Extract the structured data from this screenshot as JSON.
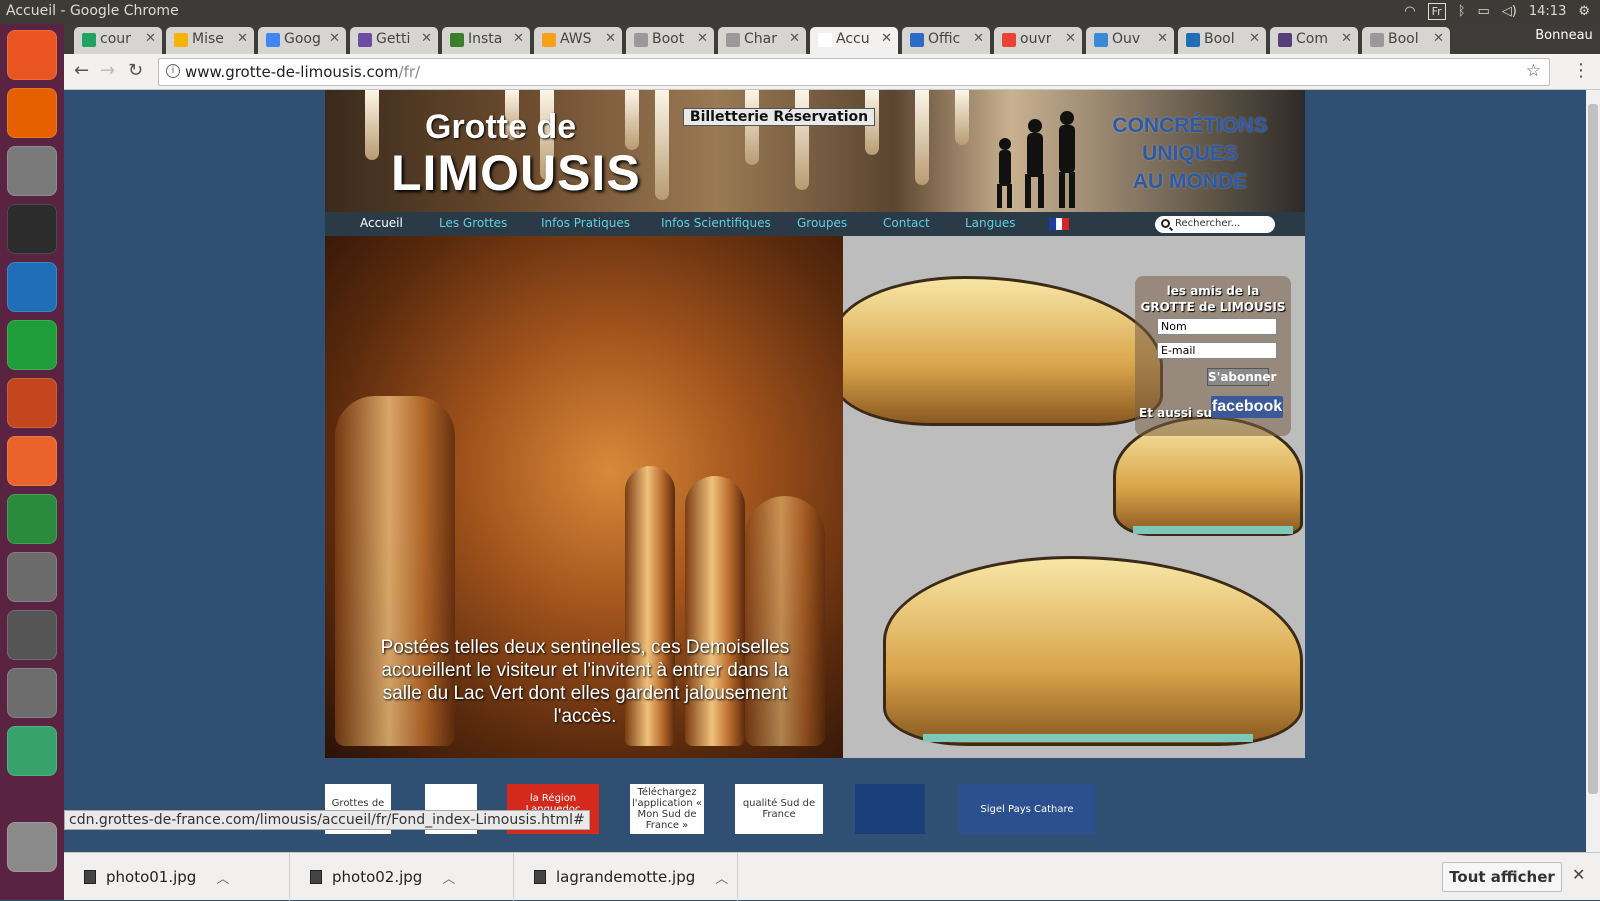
{
  "os": {
    "window_title": "Accueil - Google Chrome",
    "keyboard_layout": "Fr",
    "clock": "14:13",
    "launcher": [
      {
        "name": "ubuntu-icon",
        "color": "#e95420"
      },
      {
        "name": "firefox-icon",
        "color": "#e66000"
      },
      {
        "name": "files-icon",
        "color": "#7a7a7a"
      },
      {
        "name": "terminal-icon",
        "color": "#2c2c2c"
      },
      {
        "name": "writer-icon",
        "color": "#1e6fb8"
      },
      {
        "name": "calc-icon",
        "color": "#1f9d3a"
      },
      {
        "name": "impress-icon",
        "color": "#c3461e"
      },
      {
        "name": "software-center-icon",
        "color": "#e9632a"
      },
      {
        "name": "chrome-icon",
        "color": "#2a8b3e"
      },
      {
        "name": "settings-icon",
        "color": "#6b6b6b"
      },
      {
        "name": "sublime-text-icon",
        "color": "#555555"
      },
      {
        "name": "gimp-icon",
        "color": "#6d6d6d"
      },
      {
        "name": "atom-icon",
        "color": "#37a26b"
      },
      {
        "name": "trash-icon",
        "color": "#8a8a8a"
      }
    ]
  },
  "browser": {
    "profile": "Bonneau",
    "tabs": [
      {
        "label": "cour",
        "color": "#1fa463"
      },
      {
        "label": "Mise",
        "color": "#f4b400"
      },
      {
        "label": "Goog",
        "color": "#4285f4"
      },
      {
        "label": "Getti",
        "color": "#6c4ea3"
      },
      {
        "label": "Insta",
        "color": "#3a7d2c"
      },
      {
        "label": "AWS",
        "color": "#f7a11a"
      },
      {
        "label": "Boot",
        "color": "#999999"
      },
      {
        "label": "Char",
        "color": "#999999"
      },
      {
        "label": "Accu",
        "color": "#ffffff"
      },
      {
        "label": "Offic",
        "color": "#2a6cc7"
      },
      {
        "label": "ouvr",
        "color": "#ea4335"
      },
      {
        "label": "Ouv",
        "color": "#3a8ad6"
      },
      {
        "label": "Bool",
        "color": "#1f6fb5"
      },
      {
        "label": "Com",
        "color": "#563d7c"
      },
      {
        "label": "Bool",
        "color": "#999999"
      }
    ],
    "active_tab_index": 8,
    "url_host": "www.grotte-de-limousis.com",
    "url_path": "/fr/",
    "status_url": "cdn.grottes-de-france.com/limousis/accueil/fr/Fond_index-Limousis.html#",
    "downloads": [
      "photo01.jpg",
      "photo02.jpg",
      "lagrandemotte.jpg"
    ],
    "show_all_label": "Tout afficher"
  },
  "site": {
    "logo_line1": "Grotte de",
    "logo_line2": "LIMOUSIS",
    "ticket_button": "Billetterie Réservation",
    "slogan": [
      "CONCRÉTIONS",
      "UNIQUES",
      "AU MONDE"
    ],
    "nav": [
      "Accueil",
      "Les Grottes",
      "Infos Pratiques",
      "Infos Scientifiques",
      "Groupes",
      "Contact",
      "Langues"
    ],
    "nav_active": "Accueil",
    "search_placeholder": "Rechercher...",
    "caption": "Postées telles deux sentinelles, ces Demoiselles accueillent le visiteur et l'invitent à entrer dans la salle du Lac Vert dont elles gardent jalousement l'accès.",
    "newsletter": {
      "title1": "les amis de la",
      "title2": "GROTTE de LIMOUSIS",
      "name_value": "Nom",
      "email_value": "E-mail",
      "submit": "S'abonner",
      "facebook_prefix": "Et aussi sur",
      "facebook_label": "facebook"
    },
    "partners": [
      {
        "label": "Grottes de France",
        "bg": "#ffffff"
      },
      {
        "label": "",
        "bg": "#ffffff"
      },
      {
        "label": "la Région Languedoc Roussillon",
        "bg": "#d42a1e"
      },
      {
        "label": "Téléchargez l'application « Mon Sud de France »",
        "bg": "#ffffff"
      },
      {
        "label": "qualité Sud de France",
        "bg": "#ffffff"
      },
      {
        "label": "",
        "bg": "#1c3f7a"
      },
      {
        "label": "Sigel Pays Cathare",
        "bg": "#2b4f8f"
      }
    ]
  }
}
